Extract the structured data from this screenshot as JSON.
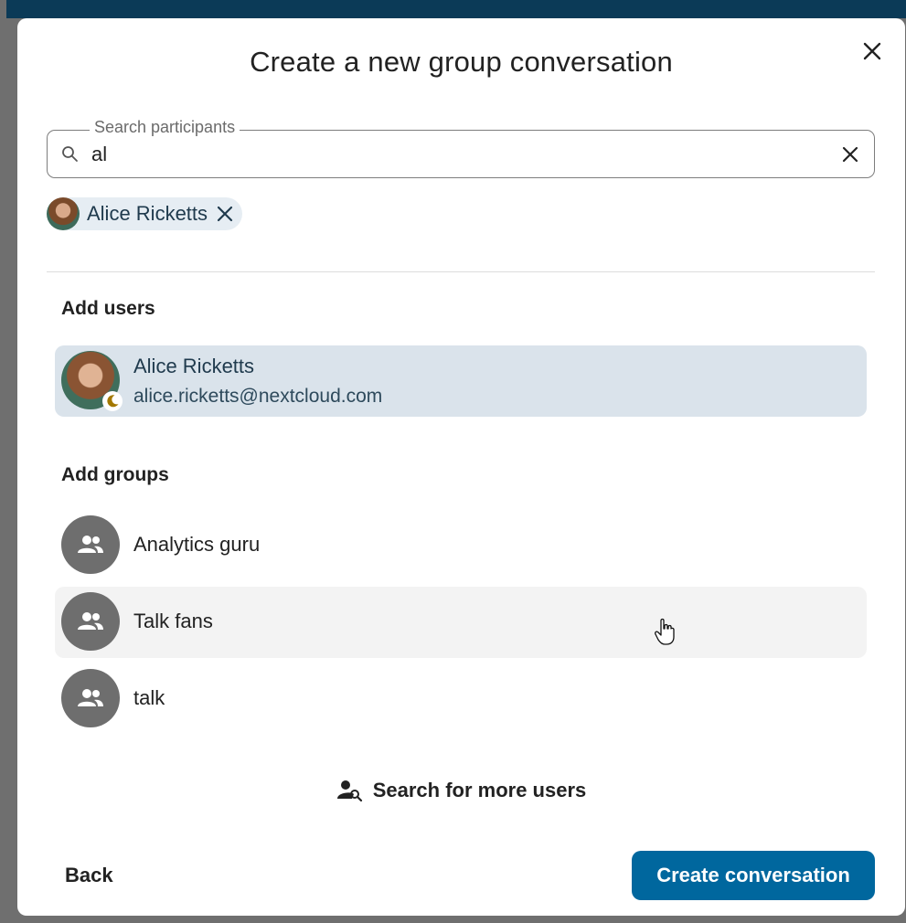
{
  "dialog": {
    "title": "Create a new group conversation"
  },
  "search": {
    "legend": "Search participants",
    "value": "al"
  },
  "selected_chips": [
    {
      "label": "Alice Ricketts"
    }
  ],
  "users_section": {
    "title": "Add users",
    "items": [
      {
        "name": "Alice Ricketts",
        "email": "alice.ricketts@nextcloud.com",
        "status_icon": "moon-icon"
      }
    ]
  },
  "groups_section": {
    "title": "Add groups",
    "items": [
      {
        "name": "Analytics guru",
        "icon": "group-icon"
      },
      {
        "name": "Talk fans",
        "icon": "group-icon"
      },
      {
        "name": "talk",
        "icon": "group-icon"
      }
    ]
  },
  "more_users": {
    "label": "Search for more users",
    "icon": "user-search-icon"
  },
  "footer": {
    "back_label": "Back",
    "create_label": "Create conversation"
  },
  "colors": {
    "primary": "#00679e",
    "selected_row": "#dae3eb",
    "chip": "#e6edf3",
    "group_avatar": "#6e6e6e",
    "top_bar": "#0b3a57"
  }
}
